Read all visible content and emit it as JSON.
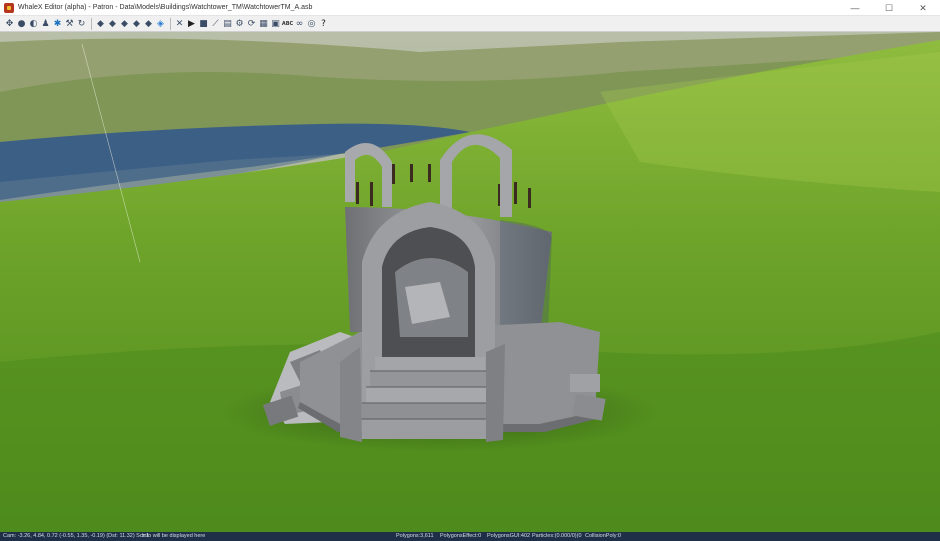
{
  "window": {
    "title": "WhaleX Editor (alpha) - Patron - Data\\Models\\Buildings\\Watchtower_TM\\WatchtowerTM_A.asb",
    "minimize_label": "—",
    "maximize_label": "☐",
    "close_label": "✕"
  },
  "toolbar": {
    "groups": [
      [
        "transform-tool-icon",
        "sphere-icon",
        "half-sphere-icon",
        "mannequin-icon",
        "lights-icon",
        "wrench-icon",
        "rotate-icon"
      ],
      [
        "brush-1-icon",
        "brush-2-icon",
        "brush-3-icon",
        "brush-4-icon",
        "brush-5-icon",
        "water-brush-icon"
      ],
      [
        "tools-icon",
        "play-icon",
        "stop-icon",
        "ruler-icon",
        "document-icon",
        "gear-icon",
        "refresh-icon",
        "grid-icon",
        "disk-icon",
        "abc-icon",
        "link-icon",
        "glasses-icon",
        "help-icon"
      ]
    ],
    "abc_label": "ABC"
  },
  "status": {
    "camera": "Cam: -3.26, 4.84, 0.72 (-0.55, 1.35, -0.19) (Dst: 11.32) Scr:1",
    "info": "Info will be displayed here",
    "polygons": "Polygons:3,611",
    "polygons_effect": "PolygonsEffect:0",
    "polygons_gui": "PolygonsGUI:402",
    "particles": "Particles:(0.000/0)(0",
    "collision": "CollisionPoly:0"
  },
  "colors": {
    "status_bg": "#1e2f47",
    "grass": "#6aa22c",
    "water": "#3c5f86",
    "stone": "#8e9094"
  }
}
